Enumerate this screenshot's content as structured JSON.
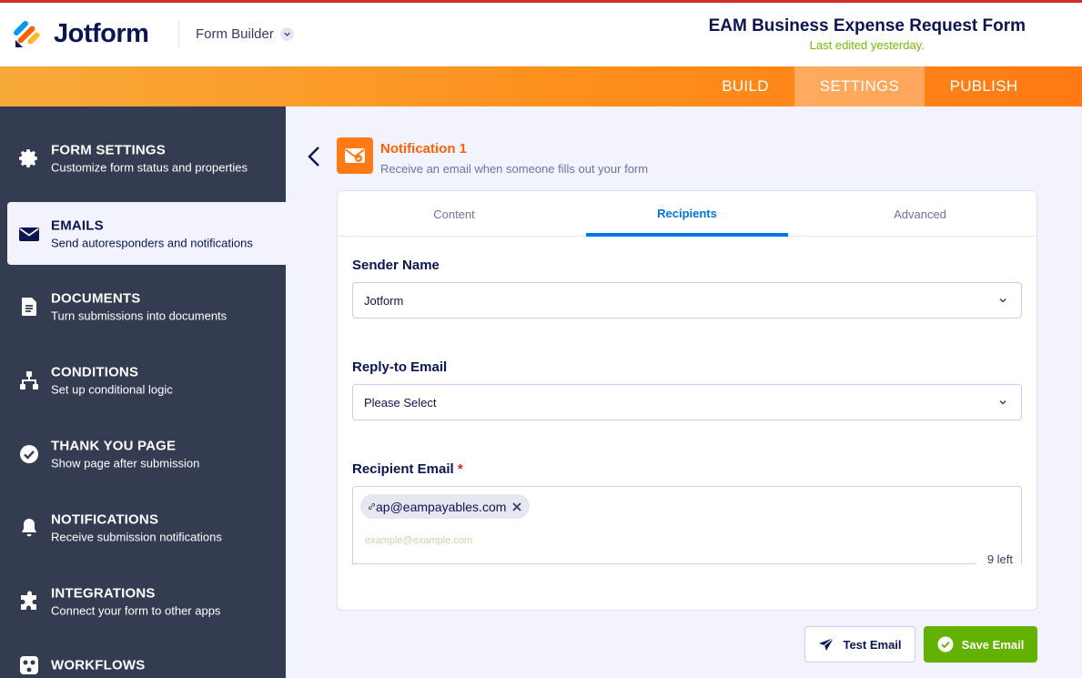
{
  "header": {
    "brand": "Jotform",
    "builder_menu": "Form Builder",
    "form_title": "EAM Business Expense Request Form",
    "last_edited": "Last edited yesterday."
  },
  "nav": {
    "build": "BUILD",
    "settings": "SETTINGS",
    "publish": "PUBLISH",
    "active": "SETTINGS"
  },
  "sidebar": {
    "items": [
      {
        "title": "FORM SETTINGS",
        "desc": "Customize form status and properties",
        "icon": "gear-icon"
      },
      {
        "title": "EMAILS",
        "desc": "Send autoresponders and notifications",
        "icon": "envelope-icon",
        "active": true
      },
      {
        "title": "DOCUMENTS",
        "desc": "Turn submissions into documents",
        "icon": "document-icon"
      },
      {
        "title": "CONDITIONS",
        "desc": "Set up conditional logic",
        "icon": "sitemap-icon"
      },
      {
        "title": "THANK YOU PAGE",
        "desc": "Show page after submission",
        "icon": "check-circle-icon"
      },
      {
        "title": "NOTIFICATIONS",
        "desc": "Receive submission notifications",
        "icon": "bell-icon"
      },
      {
        "title": "INTEGRATIONS",
        "desc": "Connect your form to other apps",
        "icon": "puzzle-icon"
      },
      {
        "title": "WORKFLOWS",
        "desc": "",
        "icon": "workflow-icon"
      }
    ]
  },
  "notification": {
    "title": "Notification 1",
    "subtitle": "Receive an email when someone fills out your form",
    "icon": "notification-envelope-icon"
  },
  "tabs": {
    "content": "Content",
    "recipients": "Recipients",
    "advanced": "Advanced",
    "active": "Recipients"
  },
  "fields": {
    "sender_name": {
      "label": "Sender Name",
      "value": "Jotform"
    },
    "reply_to": {
      "label": "Reply-to Email",
      "value": "Please Select"
    },
    "recipient": {
      "label": "Recipient Email",
      "required_mark": "*",
      "chips": [
        "ap@eampayables.com"
      ],
      "placeholder": "example@example.com",
      "remaining": "9 left"
    }
  },
  "actions": {
    "test_email": "Test Email",
    "save_email": "Save Email"
  },
  "colors": {
    "accent_orange": "#ff6100",
    "active_blue": "#0075e3",
    "save_green": "#64b200",
    "sidebar_bg": "#343c52",
    "last_edited_green": "#78bb07"
  }
}
